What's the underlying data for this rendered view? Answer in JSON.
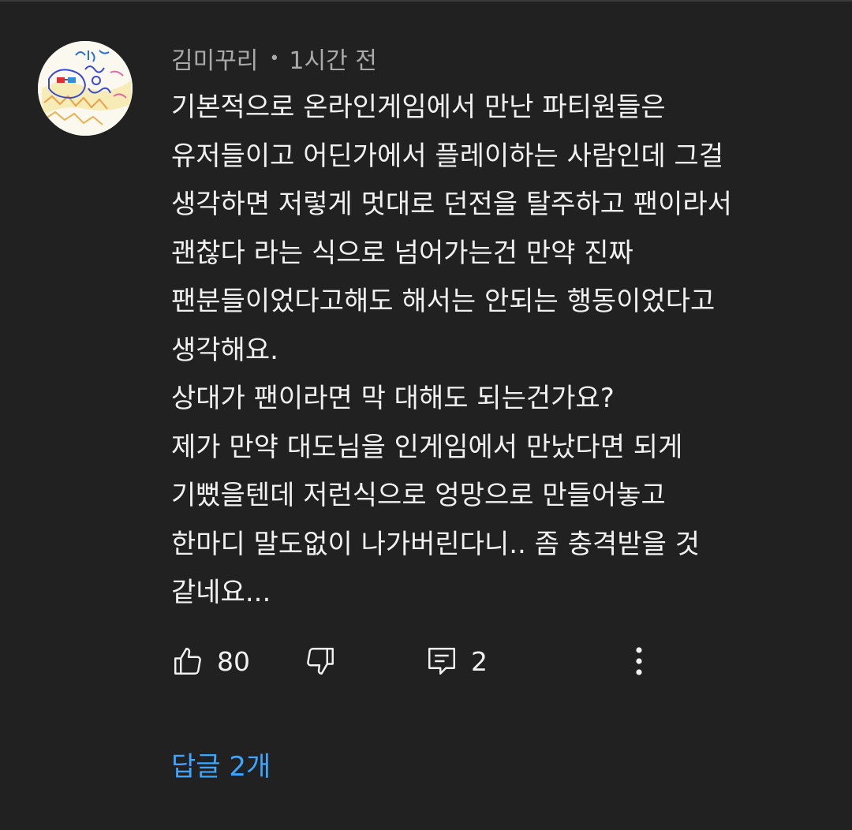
{
  "comment": {
    "author": "김미꾸리",
    "separator": "•",
    "timestamp": "1시간 전",
    "body_lines": [
      "기본적으로 온라인게임에서 만난 파티원들은",
      "유저들이고 어딘가에서 플레이하는 사람인데 그걸",
      "생각하면 저렇게 멋대로 던전을 탈주하고 팬이라서",
      "괜찮다 라는 식으로 넘어가는건 만약 진짜",
      "팬분들이었다고해도 해서는 안되는 행동이었다고",
      "생각해요.",
      "상대가 팬이라면 막 대해도 되는건가요?",
      "제가 만약 대도님을 인게임에서 만났다면 되게",
      "기뻤을텐데 저런식으로 엉망으로 만들어놓고",
      "한마디 말도없이 나가버린다니.. 좀 충격받을 것",
      "같네요..."
    ],
    "avatar_icon": "hand-drawn-doodle-avatar"
  },
  "actions": {
    "like_icon": "thumbs-up-icon",
    "like_count": "80",
    "dislike_icon": "thumbs-down-icon",
    "reply_icon": "comment-icon",
    "reply_count": "2",
    "more_icon": "more-vertical-icon"
  },
  "replies": {
    "label": "답글 2개"
  },
  "colors": {
    "background": "#212121",
    "text_primary": "#f1f1f1",
    "text_secondary": "#aaaaaa",
    "link": "#3ea6ff"
  }
}
